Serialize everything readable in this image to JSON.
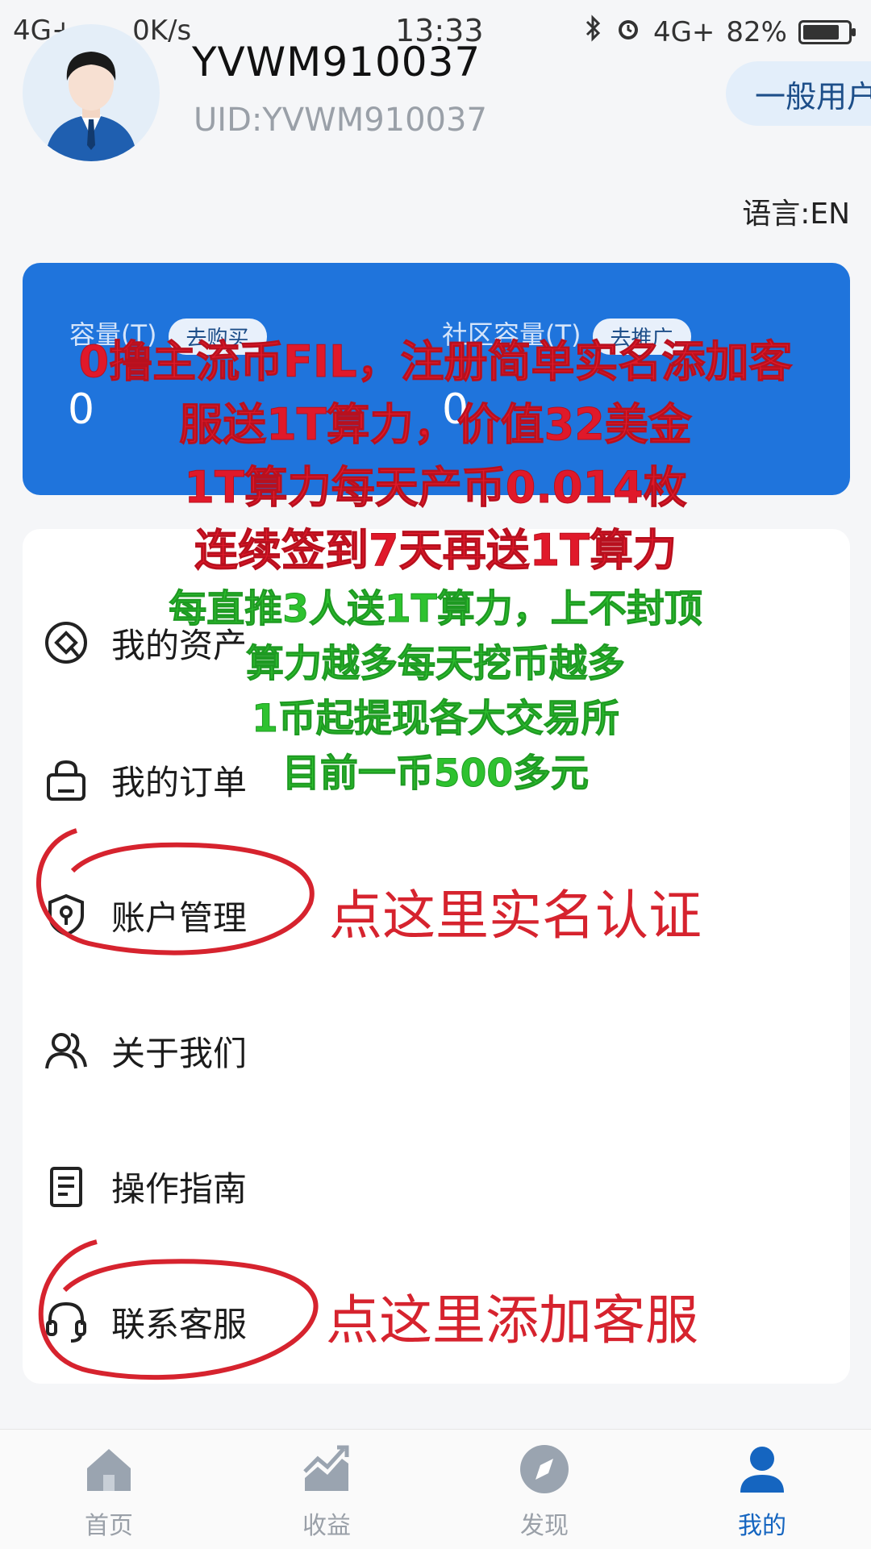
{
  "status_bar": {
    "network": "4G+",
    "speed": "0K/s",
    "time": "13:33",
    "network_right": "4G+",
    "battery": "82%",
    "battery_level": 0.82
  },
  "profile": {
    "username": "YVWM910037",
    "uid": "UID:YVWM910037",
    "role": "一般用户",
    "language": "语言:EN"
  },
  "capacity_card": {
    "left_label": "容量(T)",
    "left_button": "去购买",
    "left_value": "0",
    "right_label": "社区容量(T)",
    "right_button": "去推广",
    "right_value": "0"
  },
  "promo": {
    "red_lines": [
      "0撸主流币FIL，注册简单实名添加客",
      "服送1T算力，价值32美金",
      "1T算力每天产币0.014枚",
      "连续签到7天再送1T算力"
    ],
    "green_lines": [
      "每直推3人送1T算力，上不封顶",
      "算力越多每天挖币越多",
      "1币起提现各大交易所",
      "目前一币500多元"
    ]
  },
  "menu": {
    "items": [
      {
        "label": "我的资产",
        "icon": "asset-icon"
      },
      {
        "label": "我的订单",
        "icon": "order-bag-icon"
      },
      {
        "label": "账户管理",
        "icon": "shield-key-icon"
      },
      {
        "label": "关于我们",
        "icon": "people-icon"
      },
      {
        "label": "操作指南",
        "icon": "guide-icon"
      },
      {
        "label": "联系客服",
        "icon": "headset-icon"
      }
    ]
  },
  "annotations": {
    "account": "点这里实名认证",
    "service": "点这里添加客服"
  },
  "bottom_nav": {
    "tabs": [
      {
        "label": "首页",
        "icon": "home-icon"
      },
      {
        "label": "收益",
        "icon": "earnings-chart-icon"
      },
      {
        "label": "发现",
        "icon": "compass-icon"
      },
      {
        "label": "我的",
        "icon": "user-icon"
      }
    ],
    "active": "我的"
  },
  "colors": {
    "card_blue": "#1f74dc",
    "promo_red": "#e0192a",
    "promo_green": "#2ec22f",
    "annotation_red": "#d6232e",
    "active_tab": "#1565c0"
  }
}
